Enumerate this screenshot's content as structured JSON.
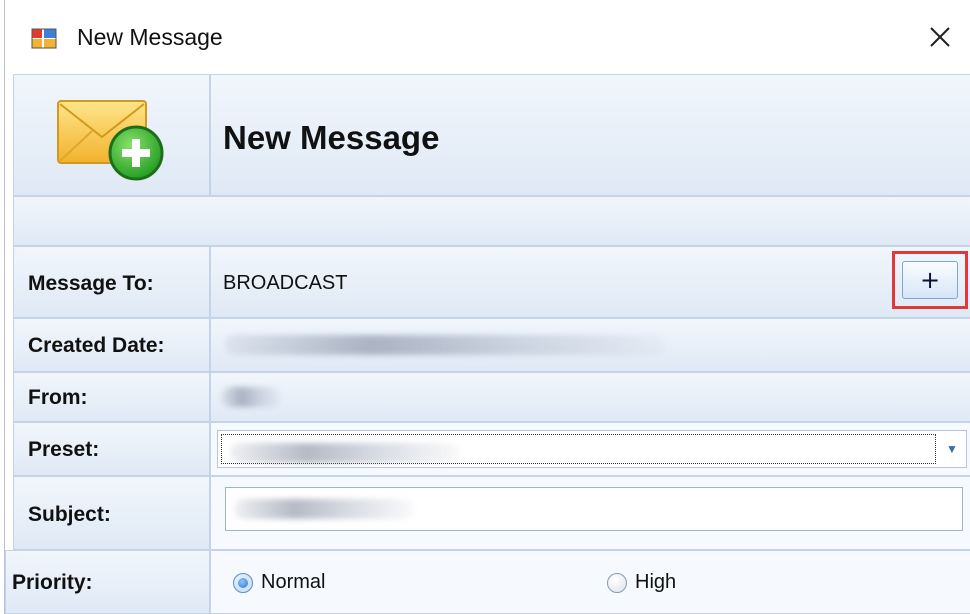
{
  "window": {
    "title": "New Message",
    "icons": {
      "app": "app-window-icon",
      "close": "close-icon"
    }
  },
  "header": {
    "title": "New Message",
    "icon": "envelope-add-icon"
  },
  "form": {
    "message_to": {
      "label": "Message To:",
      "value": "BROADCAST",
      "add_button": "+"
    },
    "created_date": {
      "label": "Created Date:"
    },
    "from": {
      "label": "From:"
    },
    "preset": {
      "label": "Preset:"
    },
    "subject": {
      "label": "Subject:"
    },
    "priority": {
      "label": "Priority:",
      "options": [
        {
          "label": "Normal",
          "selected": true
        },
        {
          "label": "High",
          "selected": false
        }
      ]
    }
  },
  "colors": {
    "highlight_box": "#e0393a",
    "cell_border": "#c4d4e6",
    "cell_gradient_top": "#f1f6fc",
    "cell_gradient_bottom": "#dfe9f5"
  }
}
